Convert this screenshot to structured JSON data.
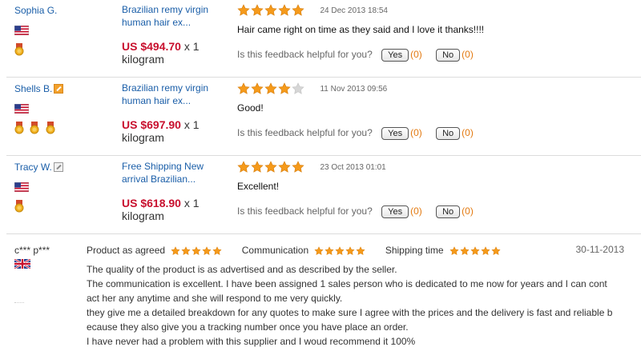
{
  "reviews": [
    {
      "user": "Sophia G.",
      "user_icon": "none",
      "medals": 1,
      "product": [
        "Brazilian remy virgin",
        "human hair ex..."
      ],
      "price": "US $494.70",
      "qty": "x 1",
      "unit": "kilogram",
      "stars": 5,
      "date": "24 Dec 2013 18:54",
      "comment": "Hair came right on time as they said and I love it thanks!!!!",
      "helpful_q": "Is this feedback helpful for you?",
      "yes": "Yes",
      "yes_count": "(0)",
      "no": "No",
      "no_count": "(0)"
    },
    {
      "user": "Shells B.",
      "user_icon": "orange",
      "medals": 3,
      "product": [
        "Brazilian remy virgin",
        "human hair ex..."
      ],
      "price": "US $697.90",
      "qty": "x 1",
      "unit": "kilogram",
      "stars": 4,
      "date": "11 Nov 2013 09:56",
      "comment": "Good!",
      "helpful_q": "Is this feedback helpful for you?",
      "yes": "Yes",
      "yes_count": "(0)",
      "no": "No",
      "no_count": "(0)"
    },
    {
      "user": "Tracy W.",
      "user_icon": "grey",
      "medals": 1,
      "product": [
        "Free Shipping New",
        "arrival Brazilian..."
      ],
      "price": "US $618.90",
      "qty": "x 1",
      "unit": "kilogram",
      "stars": 5,
      "date": "23 Oct 2013 01:01",
      "comment": "Excellent!",
      "helpful_q": "Is this feedback helpful for you?",
      "yes": "Yes",
      "yes_count": "(0)",
      "no": "No",
      "no_count": "(0)"
    }
  ],
  "review4": {
    "user": "c*** p***",
    "flag": "uk-flag",
    "ratings": [
      {
        "label": "Product as agreed",
        "stars": 5
      },
      {
        "label": "Communication",
        "stars": 5
      },
      {
        "label": "Shipping time",
        "stars": 5
      }
    ],
    "date": "30-11-2013",
    "lines": [
      "The quality of the product is as advertised and as described by the seller.",
      "The communication is excellent. I have been assigned 1 sales person who is dedicated to me now for years and I can cont",
      "act her any anytime and she will respond to me very quickly.",
      "they give me a detailed breakdown for any quotes to make sure I agree with the prices and the delivery is fast and reliable b",
      "ecause they also give you a tracking number once you have place an order.",
      "I have never had a problem with this supplier and I woud recommend it 100%"
    ]
  },
  "colors": {
    "link": "#1a5ea8",
    "price": "#c8102e",
    "star": "#f59a1b",
    "star_empty": "#d6d6d6",
    "count": "#e37a11"
  },
  "icons": {
    "us_flag": "us-flag-icon",
    "uk_flag": "uk-flag-icon",
    "medal": "medal-icon",
    "star": "star-icon"
  }
}
